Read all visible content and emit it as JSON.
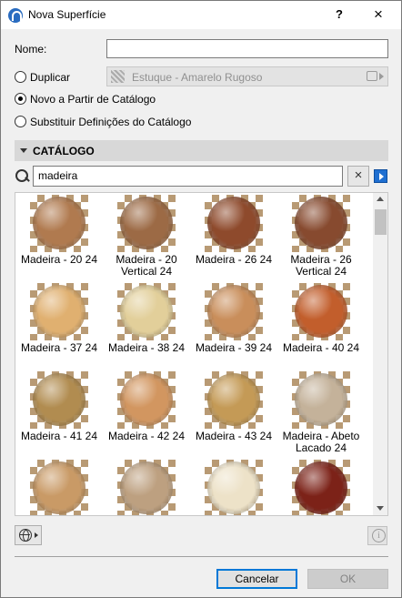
{
  "window": {
    "title": "Nova Superfície",
    "help_label": "?",
    "close_label": "×"
  },
  "form": {
    "name_label": "Nome:",
    "name_value": "",
    "options": [
      {
        "label": "Duplicar",
        "checked": false
      },
      {
        "label": "Novo a Partir de Catálogo",
        "checked": true
      },
      {
        "label": "Substituir Definições do Catálogo",
        "checked": false
      }
    ],
    "duplicate_source": "Estuque - Amarelo Rugoso"
  },
  "catalog": {
    "title": "CATÁLOGO",
    "search_value": "madeira",
    "clear_label": "×",
    "items": [
      {
        "label": "Madeira - 20 24",
        "color": "#b07a4f"
      },
      {
        "label": "Madeira - 20 Vertical 24",
        "color": "#9c6a45"
      },
      {
        "label": "Madeira - 26 24",
        "color": "#8e4a2c"
      },
      {
        "label": "Madeira - 26 Vertical 24",
        "color": "#874a2f"
      },
      {
        "label": "Madeira - 37 24",
        "color": "#e0b070"
      },
      {
        "label": "Madeira - 38 24",
        "color": "#e2cf9a"
      },
      {
        "label": "Madeira - 39 24",
        "color": "#c98e5b"
      },
      {
        "label": "Madeira - 40 24",
        "color": "#c25e2c"
      },
      {
        "label": "Madeira - 41 24",
        "color": "#b18c50"
      },
      {
        "label": "Madeira - 42 24",
        "color": "#d29660"
      },
      {
        "label": "Madeira - 43 24",
        "color": "#c49a56"
      },
      {
        "label": "Madeira - Abeto Lacado 24",
        "color": "#c4b29a"
      },
      {
        "label": "",
        "color": "#c99a66"
      },
      {
        "label": "",
        "color": "#bda080"
      },
      {
        "label": "",
        "color": "#ede2c8"
      },
      {
        "label": "",
        "color": "#7c2218"
      }
    ]
  },
  "footer": {
    "cancel_label": "Cancelar",
    "ok_label": "OK"
  }
}
